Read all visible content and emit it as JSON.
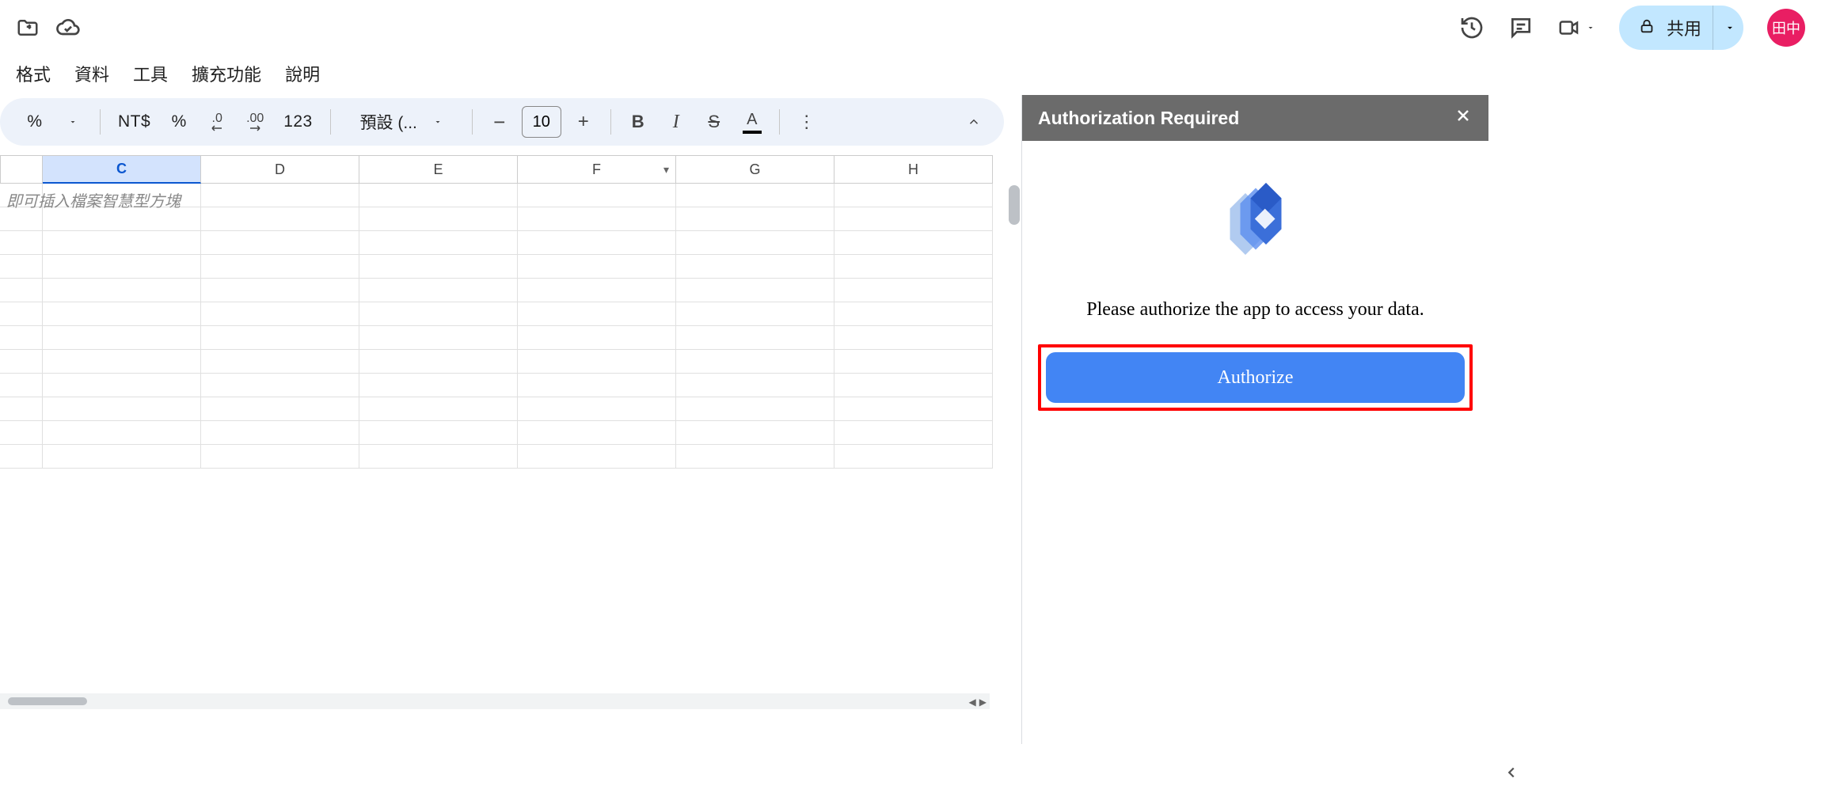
{
  "titlebar": {
    "move_icon": "folder-move-icon",
    "cloud_icon": "cloud-done-icon",
    "share_label": "共用",
    "avatar_text": "田中"
  },
  "menubar": {
    "items": [
      "格式",
      "資料",
      "工具",
      "擴充功能",
      "說明"
    ]
  },
  "toolbar": {
    "percent": "%",
    "currency": "NT$",
    "percent2": "%",
    "dec_dec": ".0",
    "inc_dec": ".00",
    "num_format": "123",
    "font_name": "預設 (...",
    "font_size": "10",
    "bold": "B",
    "italic": "I",
    "strike": "S",
    "text_color": "A"
  },
  "sheet": {
    "columns": [
      "",
      "C",
      "D",
      "E",
      "F",
      "G",
      "H"
    ],
    "selected_column_index": 1,
    "dropdown_column_index": 4,
    "placeholder": "即可插入檔案智慧型方塊",
    "row_count": 12
  },
  "side_panel": {
    "title": "Authorization Required",
    "message": "Please authorize the app to access your data.",
    "button": "Authorize"
  }
}
